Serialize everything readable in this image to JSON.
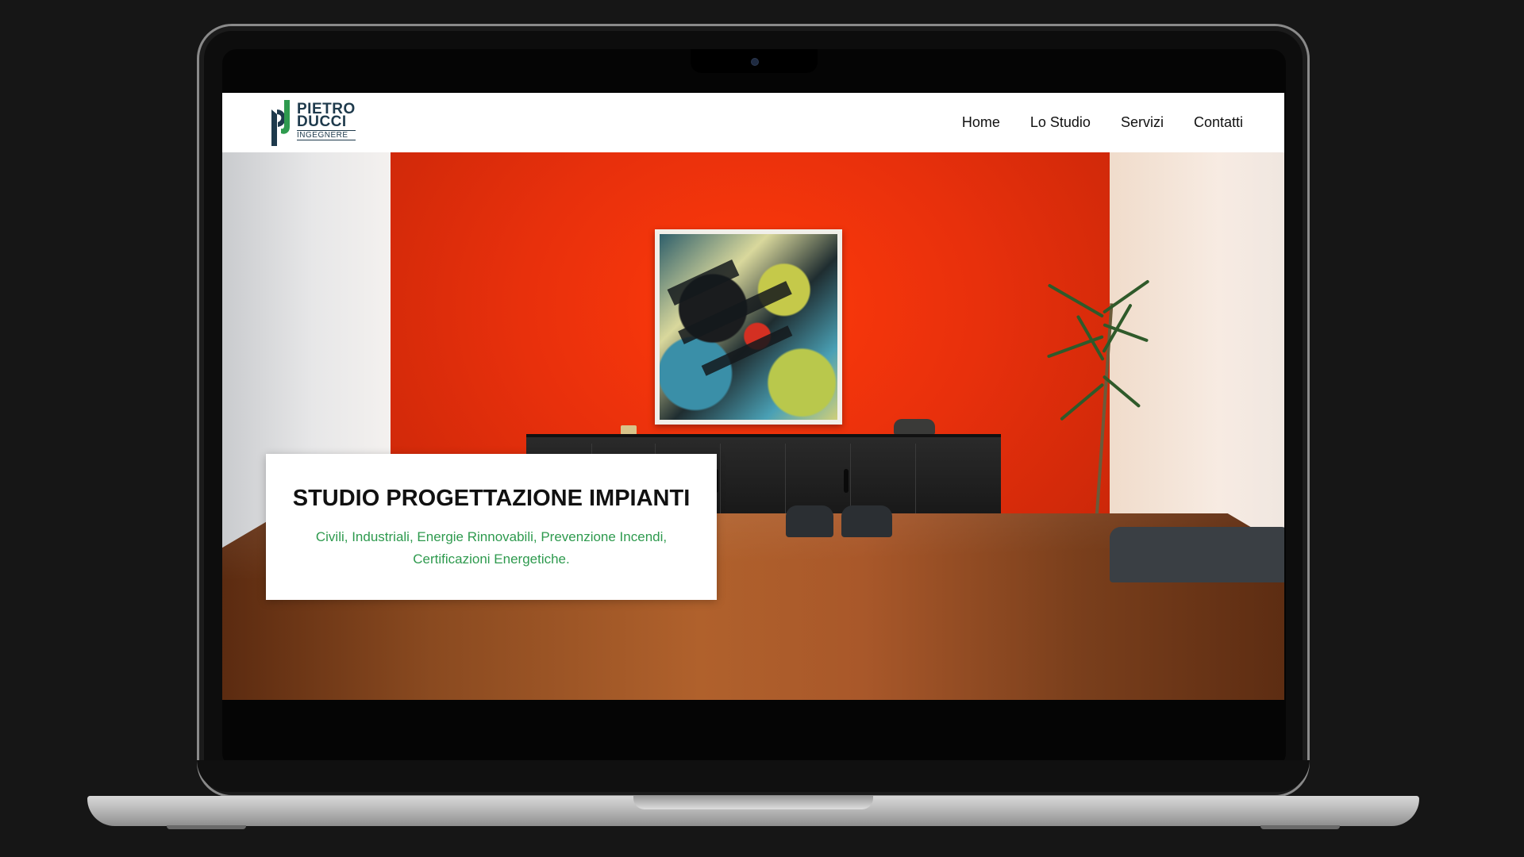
{
  "brand": {
    "logo_line1": "PIETRO",
    "logo_line2": "DUCCI",
    "logo_line3": "INGEGNERE",
    "logo_color": "#1e3a4c",
    "logo_accent": "#2e9a4e"
  },
  "nav": {
    "items": [
      {
        "label": "Home"
      },
      {
        "label": "Lo Studio"
      },
      {
        "label": "Servizi"
      },
      {
        "label": "Contatti"
      }
    ]
  },
  "hero": {
    "title": "STUDIO PROGETTAZIONE IMPIANTI",
    "subtitle": "Civili, Industriali, Energie Rinnovabili, Prevenzione Incendi, Certificazioni Energetiche.",
    "subtitle_color": "#2e9a4e"
  },
  "icons": {
    "camera": "camera-icon",
    "logo": "pd-logo-icon"
  }
}
